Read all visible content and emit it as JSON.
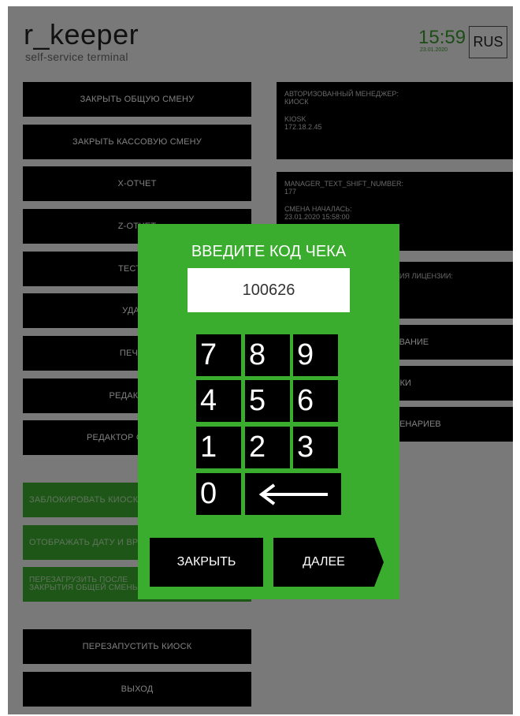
{
  "header": {
    "logo": "r_keeper",
    "subtitle": "self-service terminal",
    "time": "15:59",
    "date": "23.01.2020",
    "lang": "RUS"
  },
  "left_buttons": [
    {
      "label": "ЗАКРЫТЬ ОБЩУЮ СМЕНУ"
    },
    {
      "label": "ЗАКРЫТЬ КАССОВУЮ СМЕНУ"
    },
    {
      "label": "Х-ОТЧЕТ"
    },
    {
      "label": "Z-ОТЧЕТ"
    },
    {
      "label": "ТЕСТ ПР"
    },
    {
      "label": "УДАЛИ"
    },
    {
      "label": "ПЕЧАТЬ"
    },
    {
      "label": "РЕДАКТОР С"
    },
    {
      "label": "РЕДАКТОР СТОП-ЛИСТ"
    }
  ],
  "toggles": [
    {
      "label": "ЗАБЛОКИРОВАТЬ КИОСК"
    },
    {
      "label": "ОТОБРАЖАТЬ ДАТУ И ВРЕМ"
    },
    {
      "label": "ПЕРЕЗАГРУЗИТЬ ПОСЛЕ\nЗАКРЫТИЯ ОБЩЕЙ СМЕНЫ"
    }
  ],
  "bottom_buttons": [
    {
      "label": "ПЕРЕЗАПУСТИТЬ КИОСК"
    },
    {
      "label": "ВЫХОД"
    }
  ],
  "info": {
    "manager_label": "АВТОРИЗОВАННЫЙ МЕНЕДЖЕР:",
    "manager_value": "КИОСК",
    "kiosk_name": "KIOSK",
    "kiosk_ip": "172.18.2.45",
    "shift_label": "MANAGER_TEXT_SHIFT_NUMBER:",
    "shift_value": "177",
    "shift_start_label": "СМЕНА НАЧАЛАСЬ:",
    "shift_start_value": "23.01.2020 15:58:00",
    "license_label": "ВИЯ ЛИЦЕНЗИИ:"
  },
  "right_buttons": [
    {
      "label": "РОВАНИЕ"
    },
    {
      "label": "ОЙКИ"
    },
    {
      "label": "СЦЕНАРИЕВ"
    }
  ],
  "modal": {
    "title": "ВВЕДИТЕ КОД ЧЕКА",
    "code_value": "100626",
    "keys": [
      "7",
      "8",
      "9",
      "4",
      "5",
      "6",
      "1",
      "2",
      "3",
      "0"
    ],
    "close_label": "ЗАКРЫТЬ",
    "next_label": "ДАЛЕЕ"
  },
  "colors": {
    "accent_green": "#3aac2e",
    "clock_green": "#3a9a2f",
    "button_black": "#000000"
  },
  "icons": {
    "backspace": "left-arrow-icon"
  }
}
